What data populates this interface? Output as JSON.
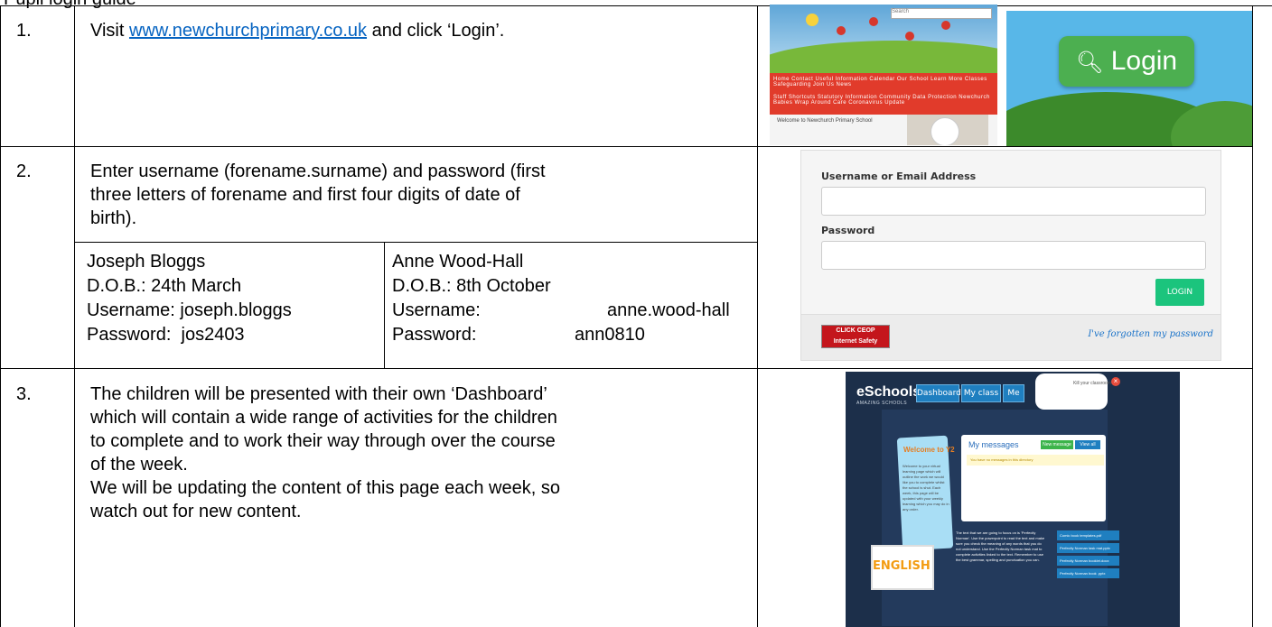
{
  "header_text": "Pupil login guide",
  "row1": {
    "num": "1.",
    "text_before": "Visit ",
    "link": "www.newchurchprimary.co.uk",
    "text_after": " and click ‘Login’."
  },
  "row2": {
    "num": "2.",
    "line1": "Enter username (forename.surname) and password (first",
    "line2": "three letters of forename and first four digits of date of",
    "line3": "birth).",
    "examples": [
      {
        "name": "Joseph Bloggs",
        "dob": "D.O.B.: 24th March",
        "username_label": "Username:",
        "username": "joseph.bloggs",
        "password_label": "Password:",
        "password": "jos2403"
      },
      {
        "name": "Anne Wood-Hall",
        "dob": "D.O.B.: 8th October",
        "username_label": "Username:",
        "username": "anne.wood-hall",
        "password_label": "Password:",
        "password": "ann0810"
      }
    ]
  },
  "row3": {
    "num": "3.",
    "lines": [
      "The children will be presented with their own ‘Dashboard’",
      "which will contain a wide range of activities for the children",
      "to complete and to work their way through over the course",
      "of the week.",
      "We will be updating the content of this page each week, so",
      "watch out for new content."
    ]
  },
  "site_thumb": {
    "nav_line1": "Home   Contact   Useful Information   Calendar   Our School   Learn More   Classes   Safeguarding   Join Us   News",
    "nav_line2": "Staff Shortcuts   Statutory Information   Community   Data Protection   Newchurch Babies Wrap Around Care   Coronavirus Update",
    "welcome": "Welcome to Newchurch Primary School",
    "search": "Search"
  },
  "login_button": "Login",
  "login_form": {
    "username_label": "Username or Email Address",
    "password_label": "Password",
    "button": "LOGIN",
    "ceop_line1": "CLICK CEOP",
    "ceop_line2": "Internet Safety",
    "forgot": "I've forgotten my password"
  },
  "dashboard": {
    "logo": "eSchools",
    "logo_sub": "AMAZING SCHOOLS",
    "tabs": [
      "Dashboard",
      "My class",
      "Me"
    ],
    "bubble": "Kill your classroom",
    "welcome_title": "Welcome to Y2",
    "welcome_body": "Welcome to your virtual learning page which will outline the work we would like you to complete whilst the school is shut. Each week, this page will be updated with your weekly learning which you may do in any order.",
    "messages_title": "My messages",
    "new_message": "New message",
    "view_all": "View all",
    "no_messages": "You have no messages in this directory",
    "english": "ENGLISH",
    "english_text": "The text that we are going to focus on is 'Perfectly Norman'. Use the powerpoint to read the text and make sure you check the meaning of any words that you do not understand. Use the Perfectly Norman task mat to complete activities linked to the text. Remember to use the best grammar, spelling and punctuation you can.",
    "files": [
      "Comic book templates.pdf",
      "Perfectly Norman task mat.pptx",
      "Perfectly Norman booklet.docx",
      "Perfectly Norman book .pptx"
    ]
  }
}
